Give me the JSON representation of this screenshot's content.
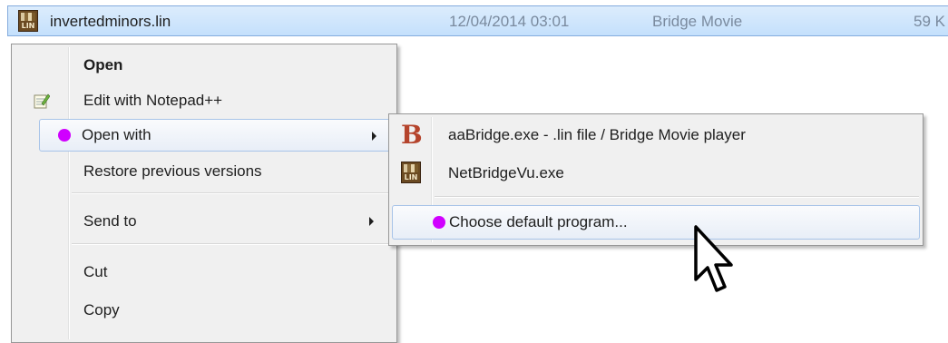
{
  "file": {
    "name": "invertedminors.lin",
    "date": "12/04/2014 03:01",
    "type": "Bridge Movie",
    "size": "59 K",
    "icon": "lin-file-icon",
    "icon_text": "LIN"
  },
  "context_menu": {
    "items": [
      {
        "label": "Open",
        "bold": true
      },
      {
        "label": "Edit with Notepad++",
        "icon": "notepad-plus-plus-icon"
      },
      {
        "label": "Open with",
        "highlighted": true,
        "has_submenu": true
      },
      {
        "label": "Restore previous versions"
      },
      {
        "label": "Send to",
        "has_submenu": true
      },
      {
        "label": "Cut"
      },
      {
        "label": "Copy"
      }
    ]
  },
  "open_with_submenu": {
    "items": [
      {
        "label": "aaBridge.exe - .lin file / Bridge Movie player",
        "icon": "aabridge-b-icon",
        "icon_text": "B"
      },
      {
        "label": "NetBridgeVu.exe",
        "icon": "netbridgevu-icon",
        "icon_text": "LIN"
      },
      {
        "label": "Choose default program...",
        "highlighted": true
      }
    ]
  },
  "colors": {
    "selection_background": "#c4e0fc",
    "highlight_border": "#a8c4e8",
    "marker_dot": "#d000ff",
    "menu_background": "#f0f0f0",
    "aabridge_icon": "#b5442c"
  }
}
